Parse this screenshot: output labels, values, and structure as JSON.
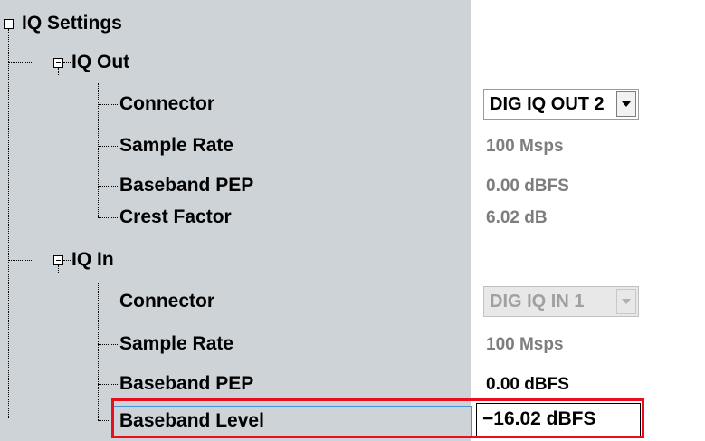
{
  "tree": {
    "root_label": "IQ Settings",
    "iq_out": {
      "label": "IQ Out",
      "connector_label": "Connector",
      "connector_value": "DIG IQ OUT 2",
      "sample_rate_label": "Sample Rate",
      "sample_rate_value": "100 Msps",
      "pep_label": "Baseband PEP",
      "pep_value": "0.00  dBFS",
      "crest_label": "Crest Factor",
      "crest_value": "6.02  dB"
    },
    "iq_in": {
      "label": "IQ In",
      "connector_label": "Connector",
      "connector_value": "DIG IQ IN 1",
      "sample_rate_label": "Sample Rate",
      "sample_rate_value": "100 Msps",
      "pep_label": "Baseband PEP",
      "pep_value": "0.00  dBFS",
      "level_label": "Baseband Level",
      "level_value": "−16.02  dBFS"
    }
  },
  "highlight_color": "#e8101e",
  "panel_color": "#ced3d8"
}
